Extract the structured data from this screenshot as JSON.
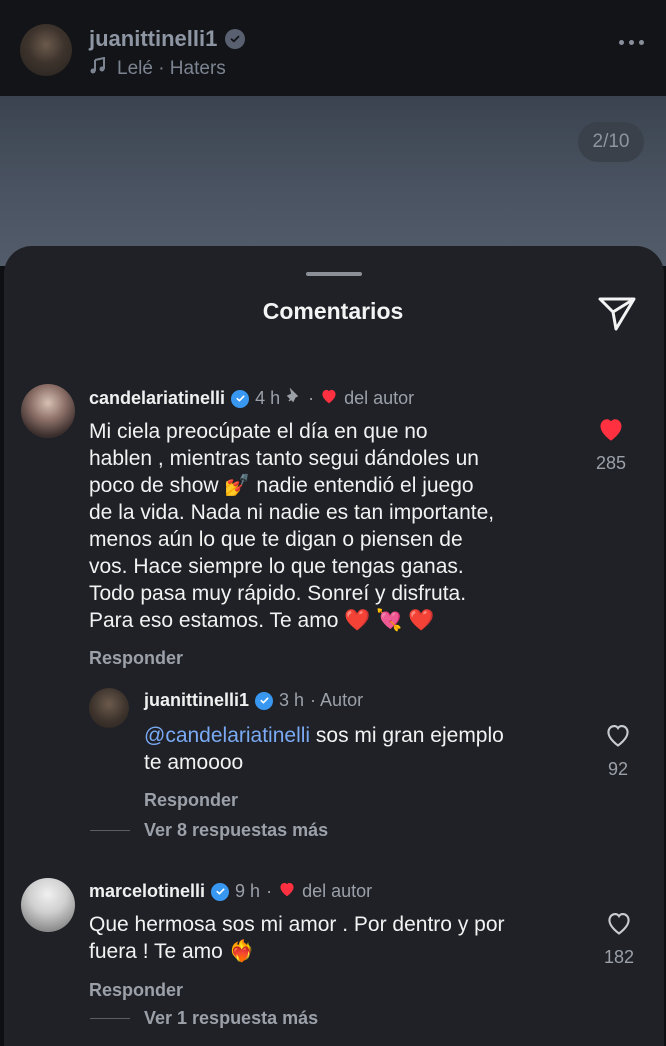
{
  "header": {
    "username": "juanittinelli1",
    "song": "Lelé · Haters",
    "photo_counter": "2/10"
  },
  "sheet": {
    "title": "Comentarios"
  },
  "comments": [
    {
      "username": "candelariatinelli",
      "time": "4 h",
      "author_badge": "del autor",
      "text_lines": [
        "Mi ciela preocúpate el día en que no",
        "hablen , mientras tanto segui dándoles un",
        "poco de show 💅 nadie entendió el juego",
        "de la vida. Nada ni nadie es tan importante,",
        "menos aún lo que te digan o piensen de",
        "vos. Hace siempre lo que tengas ganas.",
        "Todo pasa muy rápido. Sonreí y disfruta.",
        "Para eso estamos. Te amo ❤️ 💘 ❤️"
      ],
      "likes": "285",
      "reply_label": "Responder"
    },
    {
      "username": "juanittinelli1",
      "time": "3 h",
      "author_badge": "· Autor",
      "mention": "@candelariatinelli",
      "text": "sos mi gran ejemplo",
      "text_line2": "te amoooo",
      "likes": "92",
      "reply_label": "Responder",
      "view_more": "Ver 8 respuestas más"
    },
    {
      "username": "marcelotinelli",
      "time": "9 h",
      "author_badge": "del autor",
      "text_line1": "Que hermosa sos mi amor . Por dentro y por",
      "text_line2": "fuera ! Te amo ❤️‍🔥",
      "likes": "182",
      "reply_label": "Responder",
      "view_more": "Ver 1 respuesta más"
    }
  ],
  "colors": {
    "accent": "#3897f0",
    "heart": "#ff3040",
    "sheet": "#1f2126"
  }
}
